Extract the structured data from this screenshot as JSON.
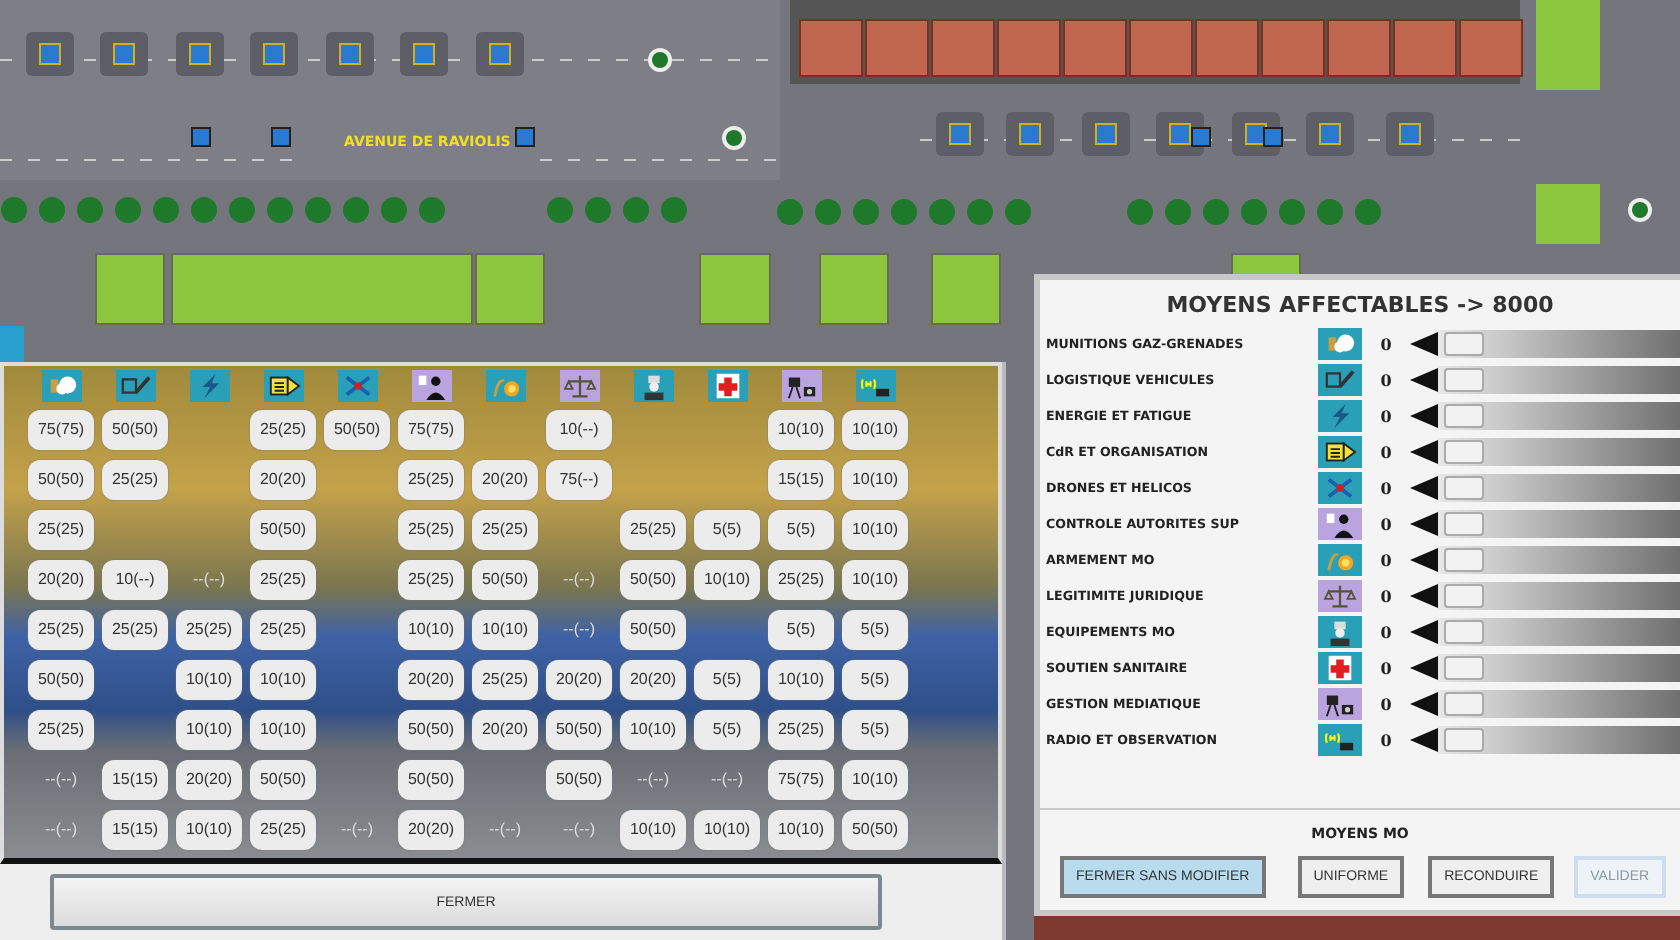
{
  "map": {
    "street_label": "AVENUE DE RAVIOLIS"
  },
  "assignment_panel": {
    "rows": [
      [
        {
          "text": "75(75)",
          "disabled": false
        },
        {
          "text": "50(50)",
          "disabled": false
        },
        null,
        {
          "text": "25(25)",
          "disabled": false
        },
        {
          "text": "50(50)",
          "disabled": false
        },
        {
          "text": "75(75)",
          "disabled": false
        },
        null,
        {
          "text": "10(--)",
          "disabled": false
        },
        null,
        null,
        {
          "text": "10(10)",
          "disabled": false
        },
        {
          "text": "10(10)",
          "disabled": false
        }
      ],
      [
        {
          "text": "50(50)",
          "disabled": false
        },
        {
          "text": "25(25)",
          "disabled": false
        },
        null,
        {
          "text": "20(20)",
          "disabled": false
        },
        null,
        {
          "text": "25(25)",
          "disabled": false
        },
        {
          "text": "20(20)",
          "disabled": false
        },
        {
          "text": "75(--)",
          "disabled": false
        },
        null,
        null,
        {
          "text": "15(15)",
          "disabled": false
        },
        {
          "text": "10(10)",
          "disabled": false
        }
      ],
      [
        {
          "text": "25(25)",
          "disabled": false
        },
        null,
        null,
        {
          "text": "50(50)",
          "disabled": false
        },
        null,
        {
          "text": "25(25)",
          "disabled": false
        },
        {
          "text": "25(25)",
          "disabled": false
        },
        null,
        {
          "text": "25(25)",
          "disabled": false
        },
        {
          "text": "5(5)",
          "disabled": false
        },
        {
          "text": "5(5)",
          "disabled": false
        },
        {
          "text": "10(10)",
          "disabled": false
        }
      ],
      [
        {
          "text": "20(20)",
          "disabled": false
        },
        {
          "text": "10(--)",
          "disabled": false
        },
        {
          "text": "--(--)",
          "disabled": true
        },
        {
          "text": "25(25)",
          "disabled": false
        },
        null,
        {
          "text": "25(25)",
          "disabled": false
        },
        {
          "text": "50(50)",
          "disabled": false
        },
        {
          "text": "--(--)",
          "disabled": true
        },
        {
          "text": "50(50)",
          "disabled": false
        },
        {
          "text": "10(10)",
          "disabled": false
        },
        {
          "text": "25(25)",
          "disabled": false
        },
        {
          "text": "10(10)",
          "disabled": false
        }
      ],
      [
        {
          "text": "25(25)",
          "disabled": false
        },
        {
          "text": "25(25)",
          "disabled": false
        },
        {
          "text": "25(25)",
          "disabled": false
        },
        {
          "text": "25(25)",
          "disabled": false
        },
        null,
        {
          "text": "10(10)",
          "disabled": false
        },
        {
          "text": "10(10)",
          "disabled": false
        },
        {
          "text": "--(--)",
          "disabled": true
        },
        {
          "text": "50(50)",
          "disabled": false
        },
        null,
        {
          "text": "5(5)",
          "disabled": false
        },
        {
          "text": "5(5)",
          "disabled": false
        }
      ],
      [
        {
          "text": "50(50)",
          "disabled": false
        },
        null,
        {
          "text": "10(10)",
          "disabled": false
        },
        {
          "text": "10(10)",
          "disabled": false
        },
        null,
        {
          "text": "20(20)",
          "disabled": false
        },
        {
          "text": "25(25)",
          "disabled": false
        },
        {
          "text": "20(20)",
          "disabled": false
        },
        {
          "text": "20(20)",
          "disabled": false
        },
        {
          "text": "5(5)",
          "disabled": false
        },
        {
          "text": "10(10)",
          "disabled": false
        },
        {
          "text": "5(5)",
          "disabled": false
        }
      ],
      [
        {
          "text": "25(25)",
          "disabled": false
        },
        null,
        {
          "text": "10(10)",
          "disabled": false
        },
        {
          "text": "10(10)",
          "disabled": false
        },
        null,
        {
          "text": "50(50)",
          "disabled": false
        },
        {
          "text": "20(20)",
          "disabled": false
        },
        {
          "text": "50(50)",
          "disabled": false
        },
        {
          "text": "10(10)",
          "disabled": false
        },
        {
          "text": "5(5)",
          "disabled": false
        },
        {
          "text": "25(25)",
          "disabled": false
        },
        {
          "text": "5(5)",
          "disabled": false
        }
      ],
      [
        {
          "text": "--(--)",
          "disabled": true
        },
        {
          "text": "15(15)",
          "disabled": false
        },
        {
          "text": "20(20)",
          "disabled": false
        },
        {
          "text": "50(50)",
          "disabled": false
        },
        null,
        {
          "text": "50(50)",
          "disabled": false
        },
        null,
        {
          "text": "50(50)",
          "disabled": false
        },
        {
          "text": "--(--)",
          "disabled": true
        },
        {
          "text": "--(--)",
          "disabled": true
        },
        {
          "text": "75(75)",
          "disabled": false
        },
        {
          "text": "10(10)",
          "disabled": false
        }
      ],
      [
        {
          "text": "--(--)",
          "disabled": true
        },
        {
          "text": "15(15)",
          "disabled": false
        },
        {
          "text": "10(10)",
          "disabled": false
        },
        {
          "text": "25(25)",
          "disabled": false
        },
        {
          "text": "--(--)",
          "disabled": true
        },
        {
          "text": "20(20)",
          "disabled": false
        },
        {
          "text": "--(--)",
          "disabled": true
        },
        {
          "text": "--(--)",
          "disabled": true
        },
        {
          "text": "10(10)",
          "disabled": false
        },
        {
          "text": "10(10)",
          "disabled": false
        },
        {
          "text": "10(10)",
          "disabled": false
        },
        {
          "text": "50(50)",
          "disabled": false
        }
      ]
    ],
    "close_button": "FERMER"
  },
  "resources_panel": {
    "title": "MOYENS AFFECTABLES -> 8000",
    "items": [
      {
        "label": "MUNITIONS GAZ-GRENADES",
        "value": "0",
        "level": 0
      },
      {
        "label": "LOGISTIQUE VEHICULES",
        "value": "0",
        "level": 0
      },
      {
        "label": "ENERGIE ET FATIGUE",
        "value": "0",
        "level": 0
      },
      {
        "label": "CdR ET ORGANISATION",
        "value": "0",
        "level": 0
      },
      {
        "label": "DRONES ET HELICOS",
        "value": "0",
        "level": 0
      },
      {
        "label": "CONTROLE AUTORITES SUP",
        "value": "0",
        "level": 0
      },
      {
        "label": "ARMEMENT MO",
        "value": "0",
        "level": 0
      },
      {
        "label": "LEGITIMITE JURIDIQUE",
        "value": "0",
        "level": 0
      },
      {
        "label": "EQUIPEMENTS MO",
        "value": "0",
        "level": 0
      },
      {
        "label": "SOUTIEN SANITAIRE",
        "value": "0",
        "level": 0
      },
      {
        "label": "GESTION MEDIATIQUE",
        "value": "0",
        "level": 0
      },
      {
        "label": "RADIO ET OBSERVATION",
        "value": "0",
        "level": 0
      }
    ],
    "section_label": "MOYENS MO",
    "buttons": [
      {
        "label": "FERMER SANS MODIFIER",
        "focused": true,
        "disabled": false
      },
      {
        "label": "UNIFORME",
        "focused": false,
        "disabled": false
      },
      {
        "label": "RECONDUIRE",
        "focused": false,
        "disabled": false
      },
      {
        "label": "VALIDER",
        "focused": false,
        "disabled": true
      }
    ]
  }
}
